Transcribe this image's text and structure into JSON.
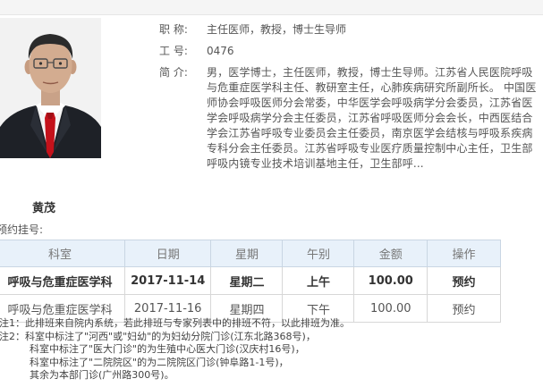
{
  "doctor": {
    "name": "黄茂",
    "title_label": "职 称:",
    "title_value": "主任医师，教授，博士生导师",
    "id_label": "工 号:",
    "id_value": "0476",
    "intro_label": "简 介:",
    "intro_value": "男，医学博士，主任医师，教授，博士生导师。江苏省人民医院呼吸与危重症医学科主任、教研室主任，心肺疾病研究所副所长。 中国医师协会呼吸医师分会常委，中华医学会呼吸病学分会委员，江苏省医学会呼吸病学分会主任委员，江苏省呼吸医师分会会长，中西医结合学会江苏省呼吸专业委员会主任委员，南京医学会结核与呼吸系疾病专科分会主任委员。江苏省呼吸专业医疗质量控制中心主任，卫生部呼吸内镜专业技术培训基地主任，卫生部呼..."
  },
  "registration_label": "预约挂号:",
  "schedule": {
    "headers": [
      "科室",
      "日期",
      "星期",
      "午别",
      "金额",
      "操作"
    ],
    "rows": [
      [
        "呼吸与危重症医学科",
        "2017-11-14",
        "星期二",
        "上午",
        "100.00",
        "预约"
      ],
      [
        "呼吸与危重症医学科",
        "2017-11-16",
        "星期四",
        "下午",
        "100.00",
        "预约"
      ]
    ]
  },
  "notes": [
    "注1：此排班来自院内系统，若此排班与专家列表中的排班不符，以此排班为准。",
    "注2：科室中标注了\"河西\"或\"妇幼\"的为妇幼分院门诊(江东北路368号)，",
    "科室中标注了\"医大门诊\"的为生殖中心医大门诊(汉庆村16号)，",
    "科室中标注了\"二院院区\"的为二院院区门诊(钟阜路1-1号)，",
    "其余为本部门诊(广州路300号)。"
  ]
}
